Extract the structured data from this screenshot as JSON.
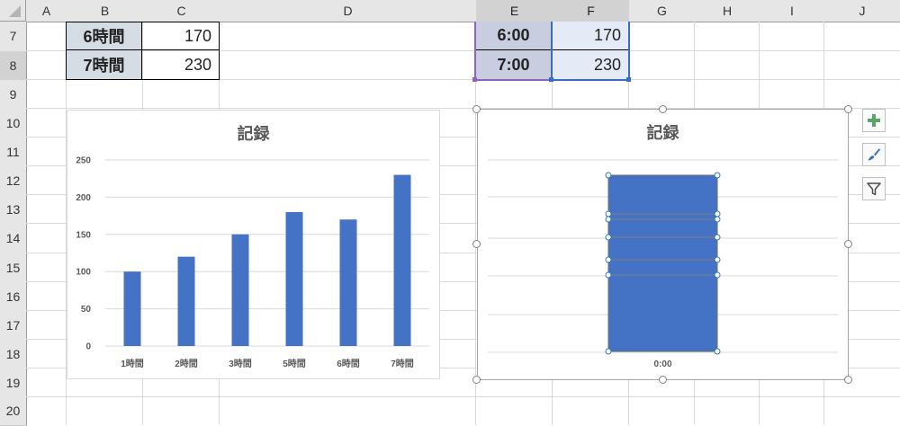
{
  "sheet": {
    "corner_icon": "select-all-triangle-icon",
    "columns": [
      "A",
      "B",
      "C",
      "D",
      "E",
      "F",
      "G",
      "H",
      "I",
      "J"
    ],
    "rows": [
      "7",
      "8",
      "9",
      "10",
      "11",
      "12",
      "13",
      "14",
      "15",
      "16",
      "17",
      "18",
      "19",
      "20"
    ],
    "table_left": [
      {
        "label": "6時間",
        "value": "170"
      },
      {
        "label": "7時間",
        "value": "230"
      }
    ],
    "table_right": [
      {
        "label": "6:00",
        "value": "170"
      },
      {
        "label": "7:00",
        "value": "230"
      }
    ]
  },
  "chart_data": [
    {
      "type": "bar",
      "title": "記録",
      "categories": [
        "1時間",
        "2時間",
        "3時間",
        "5時間",
        "6時間",
        "7時間"
      ],
      "values": [
        100,
        120,
        150,
        180,
        170,
        230
      ],
      "ylim": [
        0,
        250
      ],
      "yticks": [
        "0",
        "50",
        "100",
        "150",
        "200",
        "250"
      ],
      "grid": true,
      "color": "#4472c4"
    },
    {
      "type": "bar",
      "title": "記録",
      "categories": [
        "0:00"
      ],
      "stacked": true,
      "grid": true,
      "selected": true,
      "color": "#4472c4"
    }
  ],
  "chart_tools": {
    "add_icon": "plus-icon",
    "style_icon": "paintbrush-icon",
    "filter_icon": "filter-icon",
    "accent_color": "#5aa469"
  }
}
